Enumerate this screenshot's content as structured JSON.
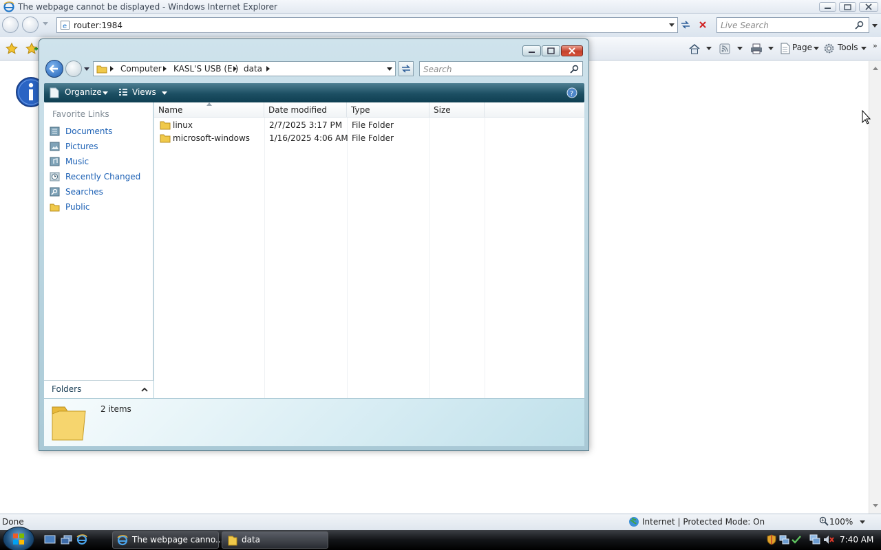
{
  "ie": {
    "title": "The webpage cannot be displayed - Windows Internet Explorer",
    "address": "router:1984",
    "search_placeholder": "Live Search",
    "toolbar": {
      "page_label": "Page",
      "tools_label": "Tools"
    },
    "status": {
      "left": "Done",
      "zone": "Internet | Protected Mode: On",
      "zoom": "100%"
    }
  },
  "explorer": {
    "breadcrumb": [
      "Computer",
      "KASL'S USB (E:)",
      "data"
    ],
    "search_placeholder": "Search",
    "toolbar": {
      "organize_label": "Organize",
      "views_label": "Views"
    },
    "favorite_links_title": "Favorite Links",
    "favorite_links": [
      {
        "label": "Documents"
      },
      {
        "label": "Pictures"
      },
      {
        "label": "Music"
      },
      {
        "label": "Recently Changed"
      },
      {
        "label": "Searches"
      },
      {
        "label": "Public"
      }
    ],
    "folders_label": "Folders",
    "columns": [
      "Name",
      "Date modified",
      "Type",
      "Size"
    ],
    "files": [
      {
        "name": "linux",
        "date": "2/7/2025 3:17 PM",
        "type": "File Folder",
        "size": ""
      },
      {
        "name": "microsoft-windows",
        "date": "1/16/2025 4:06 AM",
        "type": "File Folder",
        "size": ""
      }
    ],
    "details": {
      "count": "2 items"
    }
  },
  "taskbar": {
    "tasks": [
      {
        "label": "The webpage canno..."
      },
      {
        "label": "data"
      }
    ],
    "clock": "7:40 AM"
  },
  "colors": {
    "explorer_toolbar": "#1c4f63",
    "link": "#1a5fb4",
    "taskbar": "#121417"
  }
}
